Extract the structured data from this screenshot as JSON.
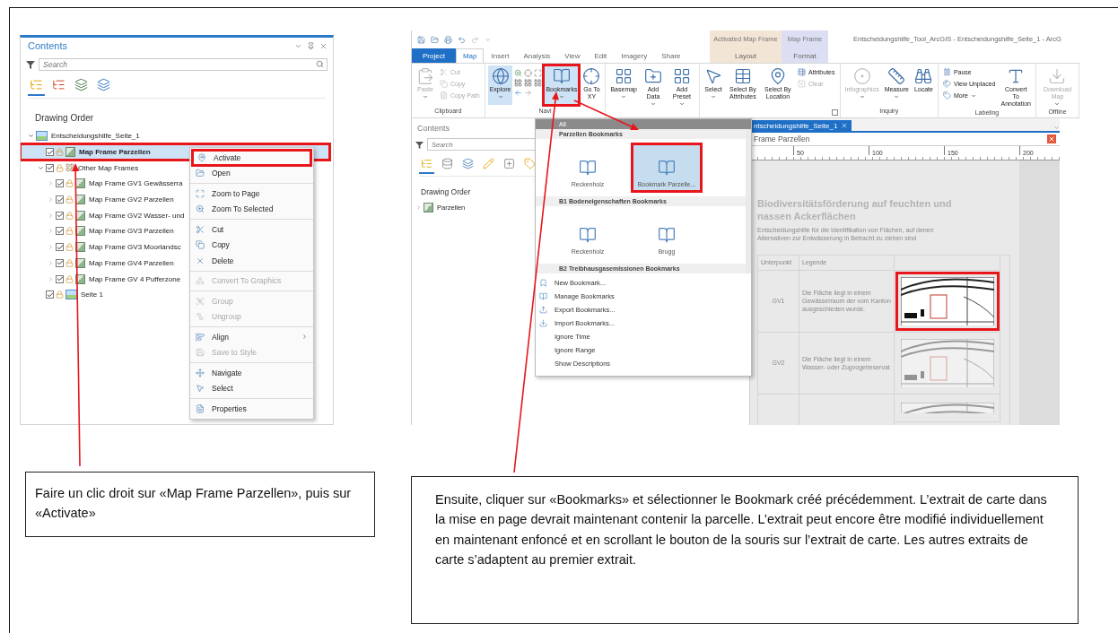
{
  "left_shot": {
    "contents": {
      "title": "Contents",
      "search": {
        "placeholder": "Search"
      },
      "view_buttons": [
        {
          "selected": true
        },
        {
          "selected": false
        },
        {
          "selected": false
        },
        {
          "selected": false
        }
      ],
      "heading": "Drawing Order",
      "tree": [
        {
          "label": "Entscheidungshilfe_Seite_1",
          "kind": "layout",
          "expanded": true,
          "selected": false,
          "highlighted": false,
          "children": [
            {
              "label": "Map Frame Parzellen",
              "kind": "map-frame",
              "checked": true,
              "selected": true,
              "highlighted": true
            },
            {
              "label": "Other Map Frames",
              "kind": "group",
              "checked": true,
              "expanded": true,
              "selected": false,
              "highlighted": false,
              "children": [
                {
                  "label": "Map Frame GV1 Gewässerra",
                  "kind": "map-frame",
                  "checked": true,
                  "expanded": false,
                  "selected": false,
                  "highlighted": false
                },
                {
                  "label": "Map Frame GV2 Parzellen",
                  "kind": "map-frame",
                  "checked": true,
                  "expanded": false,
                  "selected": false,
                  "highlighted": false
                },
                {
                  "label": "Map Frame GV2 Wasser- und",
                  "kind": "map-frame",
                  "checked": true,
                  "expanded": false,
                  "selected": false,
                  "highlighted": false
                },
                {
                  "label": "Map Frame GV3 Parzellen",
                  "kind": "map-frame",
                  "checked": true,
                  "expanded": false,
                  "selected": false,
                  "highlighted": false
                },
                {
                  "label": "Map Frame GV3 Moorlandsc",
                  "kind": "map-frame",
                  "checked": true,
                  "expanded": false,
                  "selected": false,
                  "highlighted": false
                },
                {
                  "label": "Map Frame GV4 Parzellen",
                  "kind": "map-frame",
                  "checked": true,
                  "expanded": false,
                  "selected": false,
                  "highlighted": false
                },
                {
                  "label": "Map Frame GV 4 Pufferzone",
                  "kind": "map-frame",
                  "checked": true,
                  "expanded": false,
                  "selected": false,
                  "highlighted": false
                }
              ]
            },
            {
              "label": "Seite 1",
              "kind": "page",
              "checked": true,
              "selected": false,
              "highlighted": false
            }
          ]
        }
      ]
    },
    "context_menu": {
      "groups": [
        [
          {
            "label": "Activate",
            "disabled": false,
            "highlighted": true,
            "submenu": false
          },
          {
            "label": "Open",
            "disabled": false,
            "highlighted": false,
            "submenu": false
          }
        ],
        [
          {
            "label": "Zoom to Page",
            "disabled": false,
            "highlighted": false,
            "submenu": false
          },
          {
            "label": "Zoom To Selected",
            "disabled": false,
            "highlighted": false,
            "submenu": false
          }
        ],
        [
          {
            "label": "Cut",
            "disabled": false,
            "highlighted": false,
            "submenu": false
          },
          {
            "label": "Copy",
            "disabled": false,
            "highlighted": false,
            "submenu": false
          },
          {
            "label": "Delete",
            "disabled": false,
            "highlighted": false,
            "submenu": false
          }
        ],
        [
          {
            "label": "Convert To Graphics",
            "disabled": true,
            "highlighted": false,
            "submenu": false
          }
        ],
        [
          {
            "label": "Group",
            "disabled": true,
            "highlighted": false,
            "submenu": false
          },
          {
            "label": "Ungroup",
            "disabled": true,
            "highlighted": false,
            "submenu": false
          }
        ],
        [
          {
            "label": "Align",
            "disabled": false,
            "highlighted": false,
            "submenu": true
          },
          {
            "label": "Save to Style",
            "disabled": true,
            "highlighted": false,
            "submenu": false
          }
        ],
        [
          {
            "label": "Navigate",
            "disabled": false,
            "highlighted": false,
            "submenu": false
          },
          {
            "label": "Select",
            "disabled": false,
            "highlighted": false,
            "submenu": false
          }
        ],
        [
          {
            "label": "Properties",
            "disabled": false,
            "highlighted": false,
            "submenu": false
          }
        ]
      ]
    }
  },
  "right_shot": {
    "title": "Entscheidungshilfe_Tool_ArcGIS - Entscheidungshilfe_Seite_1 - ArcG",
    "tabs": [
      {
        "label": "Project",
        "kind": "backstage",
        "selected": false
      },
      {
        "label": "Map",
        "kind": "tab",
        "selected": true
      },
      {
        "label": "Insert",
        "kind": "tab",
        "selected": false
      },
      {
        "label": "Analysis",
        "kind": "tab",
        "selected": false
      },
      {
        "label": "View",
        "kind": "tab",
        "selected": false
      },
      {
        "label": "Edit",
        "kind": "tab",
        "selected": false
      },
      {
        "label": "Imagery",
        "kind": "tab",
        "selected": false
      },
      {
        "label": "Share",
        "kind": "tab",
        "selected": false
      }
    ],
    "contextual_tabs": [
      {
        "header": "Activated Map Frame",
        "color": "#f3e5d6",
        "tab": {
          "label": "Layout",
          "selected": false
        }
      },
      {
        "header": "Map Frame",
        "color": "#dcdff3",
        "tab": {
          "label": "Format",
          "selected": false
        }
      }
    ],
    "ribbon": [
      {
        "label": "Clipboard",
        "buttons": [
          {
            "label": "Paste",
            "kind": "large",
            "disabled": true,
            "pressed": false,
            "menu": true,
            "highlighted": false
          },
          {
            "label": "Cut",
            "kind": "small",
            "disabled": true,
            "pressed": false,
            "menu": false,
            "highlighted": false
          },
          {
            "label": "Copy",
            "kind": "small",
            "disabled": true,
            "pressed": false,
            "menu": false,
            "highlighted": false
          },
          {
            "label": "Copy Path",
            "kind": "small",
            "disabled": true,
            "pressed": false,
            "menu": false,
            "highlighted": false
          }
        ]
      },
      {
        "label": "Navi",
        "buttons": [
          {
            "label": "Explore",
            "kind": "large",
            "disabled": false,
            "pressed": true,
            "menu": true,
            "highlighted": false
          },
          {
            "kind": "nav"
          },
          {
            "label": "Bookmarks",
            "kind": "large",
            "disabled": false,
            "pressed": true,
            "menu": true,
            "highlighted": true
          },
          {
            "label": "Go To XY",
            "kind": "large",
            "disabled": false,
            "pressed": false,
            "menu": false,
            "highlighted": false
          }
        ]
      },
      {
        "buttons": [
          {
            "label": "Basemap",
            "kind": "large",
            "disabled": false,
            "pressed": false,
            "menu": true,
            "highlighted": false
          },
          {
            "label": "Add Data",
            "kind": "large",
            "disabled": false,
            "pressed": false,
            "menu": true,
            "highlighted": false
          },
          {
            "label": "Add Preset",
            "kind": "large",
            "disabled": false,
            "pressed": false,
            "menu": true,
            "highlighted": false
          }
        ]
      },
      {
        "launcher": true,
        "buttons": [
          {
            "label": "Select",
            "kind": "large",
            "disabled": false,
            "pressed": false,
            "menu": true,
            "highlighted": false
          },
          {
            "label": "Select By Attributes",
            "kind": "large",
            "disabled": false,
            "pressed": false,
            "menu": false,
            "highlighted": false
          },
          {
            "label": "Select By Location",
            "kind": "large",
            "disabled": false,
            "pressed": false,
            "menu": false,
            "highlighted": false
          },
          {
            "label": "Attributes",
            "kind": "small",
            "disabled": false,
            "pressed": false,
            "menu": false,
            "highlighted": false
          },
          {
            "label": "Clear",
            "kind": "small",
            "disabled": true,
            "pressed": false,
            "menu": false,
            "highlighted": false
          }
        ]
      },
      {
        "label": "Inquiry",
        "buttons": [
          {
            "label": "Infographics",
            "kind": "large",
            "disabled": true,
            "pressed": false,
            "menu": true,
            "highlighted": false
          },
          {
            "label": "Measure",
            "kind": "large",
            "disabled": false,
            "pressed": false,
            "menu": true,
            "highlighted": false
          },
          {
            "label": "Locate",
            "kind": "large",
            "disabled": false,
            "pressed": false,
            "menu": false,
            "highlighted": false
          }
        ]
      },
      {
        "label": "Labeling",
        "buttons": [
          {
            "label": "Pause",
            "kind": "small",
            "disabled": false,
            "pressed": false,
            "menu": false,
            "highlighted": false
          },
          {
            "label": "View Unplaced",
            "kind": "small",
            "disabled": false,
            "pressed": false,
            "menu": false,
            "highlighted": false
          },
          {
            "label": "More",
            "kind": "small",
            "disabled": false,
            "pressed": false,
            "menu": true,
            "highlighted": false
          },
          {
            "label": "Convert To Annotation",
            "kind": "large",
            "disabled": false,
            "pressed": false,
            "menu": false,
            "highlighted": false
          }
        ]
      },
      {
        "label": "Offline",
        "buttons": [
          {
            "label": "Download Map",
            "kind": "large",
            "disabled": true,
            "pressed": false,
            "menu": true,
            "highlighted": false
          }
        ]
      }
    ],
    "contents": {
      "title": "Contents",
      "search": {
        "placeholder": "Search"
      },
      "view_buttons": [
        {
          "selected": true
        },
        {
          "selected": false
        },
        {
          "selected": false
        },
        {
          "selected": false
        },
        {
          "selected": false
        },
        {
          "selected": false
        }
      ],
      "heading": "Drawing Order",
      "tree": [
        {
          "label": "Parzellen",
          "expanded": false
        }
      ]
    },
    "bookmark_menu": {
      "filter": "All",
      "sections": [
        {
          "title": "Parzellen Bookmarks",
          "items": [
            {
              "label": "Reckenholz",
              "selected": false,
              "highlighted": false
            },
            {
              "label": "Bookmark Parzelle...",
              "selected": true,
              "highlighted": true
            }
          ]
        },
        {
          "title": "B1 Bodeneigenschaften Bookmarks",
          "items": [
            {
              "label": "Reckenholz",
              "selected": false,
              "highlighted": false
            },
            {
              "label": "Brugg",
              "selected": false,
              "highlighted": false
            }
          ]
        },
        {
          "title": "B2 Treibhausgasemissionen Bookmarks"
        }
      ],
      "commands": [
        "New Bookmark...",
        "Manage Bookmarks",
        "Export Bookmarks...",
        "Import Bookmarks...",
        "Ignore Time",
        "Ignore Range",
        "Show Descriptions"
      ]
    },
    "view": {
      "tab": "ntscheidungshilfe_Seite_1",
      "frame_bar": "Frame Parzellen",
      "ruler": [
        "50",
        "100",
        "150",
        "200"
      ],
      "page": {
        "title": "Biodiversitätsförderung auf feuchten und nassen Ackerflächen",
        "subtitle": "Entscheidungshilfe für die Identifikation von Flächen, auf denen Alternativen zur Entwässerung in Betracht zu ziehen sind",
        "columns": [
          "Unterpunkt",
          "Legende"
        ],
        "rows": [
          {
            "item": "GV1",
            "description": "Die Fläche liegt in einem Gewässerraum der vom Kanton ausgeschieden wurde.",
            "highlighted": true
          },
          {
            "item": "GV2",
            "description": "Die Fläche liegt in einem Wasser- oder Zugvogelreservat",
            "highlighted": false
          },
          {
            "highlighted": false
          }
        ]
      }
    }
  },
  "callouts": [
    {
      "text": "Faire un clic droit sur «Map Frame Parzellen», puis sur «Activate»"
    },
    {
      "text": "Ensuite, cliquer sur «Bookmarks» et sélectionner le Bookmark créé précédemment. L’extrait de carte dans la mise en page devrait maintenant contenir la parcelle. L’extrait peut encore être modifié individuellement en maintenant enfoncé et en scrollant le bouton de la souris sur l’extrait de carte. Les autres extraits de carte s’adaptent au premier extrait."
    }
  ]
}
